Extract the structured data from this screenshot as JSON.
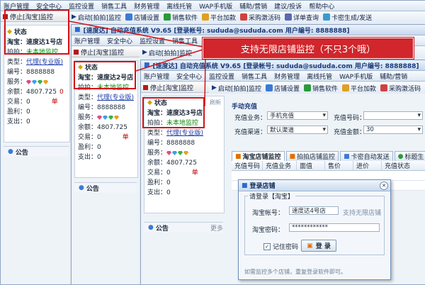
{
  "menu": [
    "账户管理",
    "安全中心",
    "监控设置",
    "销售工具",
    "财务管理",
    "离线托管",
    "WAP手机版",
    "辅助/营销",
    "建议/投诉",
    "帮助中心"
  ],
  "toolbar": {
    "stop_label": "停止[淘宝]监控",
    "start_label": "启动[拍拍]监控",
    "shop_settings": "店铺设置",
    "sales_software": "销售软件",
    "platform_plus": "平台加款",
    "buy_cards": "采购激活码",
    "detail_query": "详单查询",
    "card_gen": "卡密生成/发送"
  },
  "app_title": "[速度达] 自动充值系统 V9.65 [登录帐号: sududa@sududa.com 用户编号: 8888888]",
  "banner": "支持无限店铺监控（不只3个哦）",
  "status_label": "状态",
  "panels": [
    {
      "shop": "淘宝：速度达1号店"
    },
    {
      "shop": "淘宝：速度达2号店"
    },
    {
      "shop": "淘宝：速度达3号店"
    }
  ],
  "info": {
    "paipai_k": "拍拍：",
    "paipai_v": "未本地监控",
    "type_k": "类型：",
    "type_v": "代理(专业版)",
    "id_k": "编号：",
    "id_v": "8888888",
    "service_k": "服务：",
    "balance_k": "余额：",
    "balance_v": "4807.725",
    "balance_unit": "0",
    "trade_k": "交易：",
    "trade_v": "0",
    "trade_unit": "单",
    "profit_k": "盈利：",
    "profit_v": "0",
    "expense_k": "支出：",
    "expense_v": "0"
  },
  "notice_label": "公告",
  "more_label": "更多",
  "refresh_label": "刷新",
  "recharge": {
    "section": "手动充值",
    "biz_label": "充值业务：",
    "biz_value": "手机充值",
    "channel_label": "充值渠道：",
    "channel_value": "默认渠道",
    "number_label": "充值号码：",
    "number_value": "",
    "amount_label": "充值金额：",
    "amount_value": "30"
  },
  "tabs": [
    "淘宝店铺监控",
    "拍拍店铺监控",
    "卡密自动发送",
    "标题生"
  ],
  "table_headers": [
    "充值号码",
    "充值业务",
    "面值",
    "售价",
    "进价",
    "充值状态"
  ],
  "dialog": {
    "title": "登录店铺",
    "group": "请登录【淘宝】",
    "account_label": "淘宝帐号：",
    "account_value": "速度达4号店",
    "account_hint": "支持无限店铺",
    "password_label": "淘宝密码：",
    "password_value": "************",
    "remember": "记住密码",
    "login": "登 录",
    "tip": "如需监控多个店铺，重复登录软件即可。"
  },
  "colors": {
    "accent_red": "#d0262c",
    "title_blue": "#1a3a78",
    "green": "#0a8a0a"
  }
}
